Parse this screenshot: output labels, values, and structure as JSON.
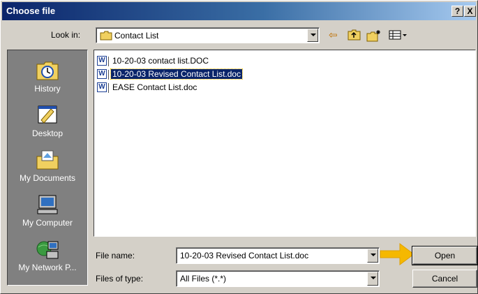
{
  "window": {
    "title": "Choose file",
    "help_glyph": "?",
    "close_glyph": "X"
  },
  "look_in": {
    "label": "Look in:",
    "value": "Contact List"
  },
  "toolbar": {
    "back_glyph": "⇦",
    "up_glyph": "⬑",
    "new_folder_glyph": "✱",
    "view_glyph": "▦▾"
  },
  "places": [
    {
      "label": "History",
      "icon": "history-icon"
    },
    {
      "label": "Desktop",
      "icon": "desktop-icon"
    },
    {
      "label": "My Documents",
      "icon": "my-documents-icon"
    },
    {
      "label": "My Computer",
      "icon": "my-computer-icon"
    },
    {
      "label": "My Network P...",
      "icon": "my-network-places-icon"
    }
  ],
  "files": [
    {
      "name": "10-20-03 contact list.DOC",
      "icon_letter": "W",
      "selected": false
    },
    {
      "name": "10-20-03 Revised Contact List.doc",
      "icon_letter": "W",
      "selected": true
    },
    {
      "name": "EASE Contact List.doc",
      "icon_letter": "W",
      "selected": false
    }
  ],
  "file_name": {
    "label": "File name:",
    "value": "10-20-03 Revised Contact List.doc"
  },
  "file_type": {
    "label": "Files of type:",
    "value": "All Files (*.*)"
  },
  "buttons": {
    "open": "Open",
    "cancel": "Cancel"
  },
  "colors": {
    "selection": "#0a246a",
    "arrow": "#f5b800",
    "places_bg": "#808080",
    "face": "#d4d0c8"
  }
}
